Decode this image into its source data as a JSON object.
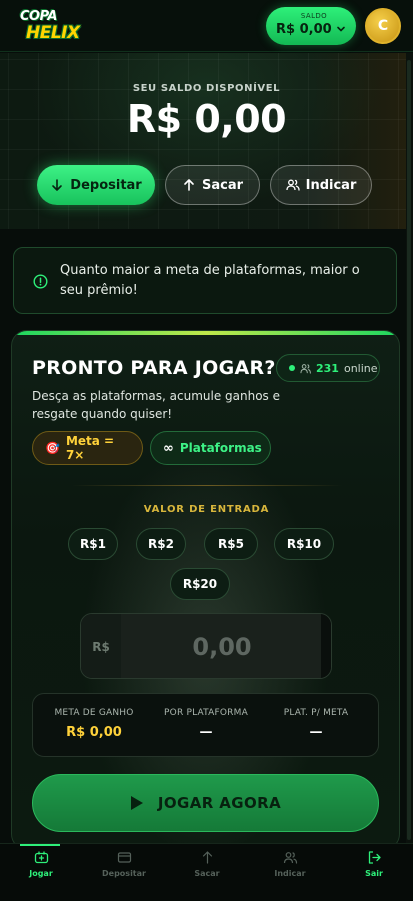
{
  "header": {
    "logo_line1": "COPA",
    "logo_line2": "HELIX",
    "balance_label": "SALDO",
    "balance_value": "R$ 0,00",
    "avatar_initial": "C"
  },
  "hero": {
    "label": "SEU SALDO DISPONÍVEL",
    "amount": "R$ 0,00",
    "buttons": {
      "deposit": "Depositar",
      "withdraw": "Sacar",
      "refer": "Indicar"
    }
  },
  "info": {
    "text": "Quanto maior a meta de plataformas, maior o seu prêmio!"
  },
  "game": {
    "title": "PRONTO PARA JOGAR?",
    "online_count": "231",
    "online_label": "online",
    "subtitle": "Desça as plataformas, acumule ganhos e resgate quando quiser!",
    "chip_meta": "Meta = 7×",
    "chip_meta_icon": "🎯",
    "chip_plat": "Plataformas",
    "chip_plat_icon": "∞",
    "entry_label": "VALOR DE ENTRADA",
    "amounts": [
      "R$1",
      "R$2",
      "R$5",
      "R$10",
      "R$20"
    ],
    "input_prefix": "R$",
    "input_placeholder": "0,00",
    "stats": [
      {
        "label": "META DE GANHO",
        "value": "R$ 0,00"
      },
      {
        "label": "POR PLATAFORMA",
        "value": "—"
      },
      {
        "label": "PLAT. P/ META",
        "value": "—"
      }
    ],
    "play_label": "JOGAR AGORA"
  },
  "nav": {
    "items": [
      "Jogar",
      "Depositar",
      "Sacar",
      "Indicar",
      "Sair"
    ]
  },
  "colors": {
    "accent_green": "#2ef07a",
    "gold": "#ffd23a",
    "background": "#070d0a"
  }
}
